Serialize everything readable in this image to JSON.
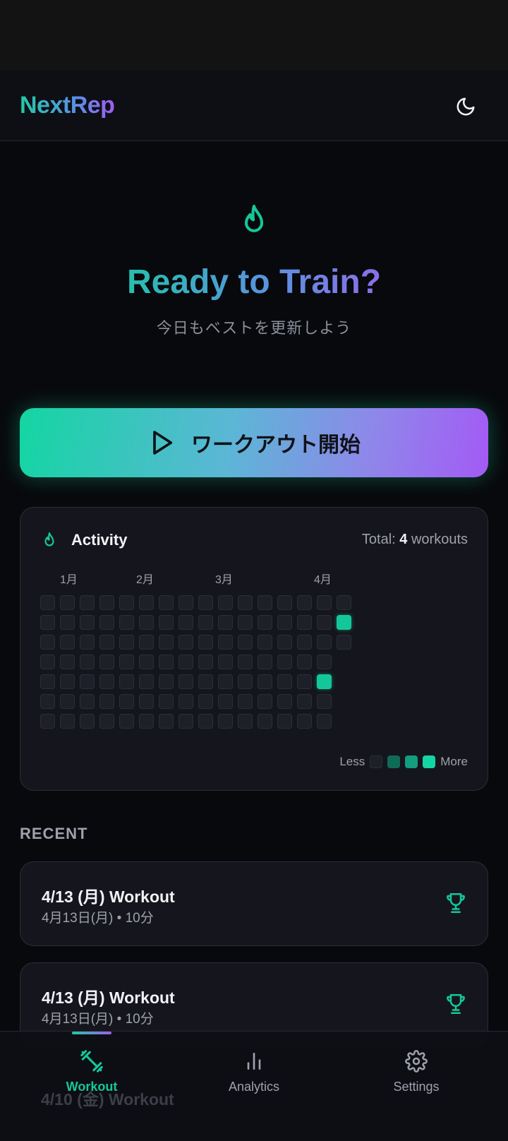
{
  "header": {
    "app_name": "NextRep",
    "theme_icon": "moon-icon"
  },
  "hero": {
    "icon": "flame-icon",
    "title": "Ready to Train?",
    "subtitle": "今日もベストを更新しよう"
  },
  "start_button": {
    "label": "ワークアウト開始",
    "icon": "play-icon"
  },
  "activity": {
    "title": "Activity",
    "total_prefix": "Total:",
    "total_count": "4",
    "total_suffix": "workouts",
    "months": [
      "1月",
      "2月",
      "3月",
      "4月"
    ],
    "weeks": 16,
    "days_per_week": 7,
    "highlighted": [
      {
        "week": 15,
        "day": 1,
        "level": 3
      },
      {
        "week": 14,
        "day": 4,
        "level": 3
      }
    ],
    "legend_less": "Less",
    "legend_more": "More",
    "legend_colors": [
      "#1e2029",
      "#0f6b57",
      "#129e7f",
      "#14d6a4"
    ],
    "accent_color": "#14c79a"
  },
  "recent": {
    "label": "RECENT",
    "items": [
      {
        "title": "4/13 (月) Workout",
        "subtitle": "4月13日(月) • 10分",
        "icon": "trophy-icon"
      },
      {
        "title": "4/13 (月) Workout",
        "subtitle": "4月13日(月) • 10分",
        "icon": "trophy-icon"
      },
      {
        "title": "4/10 (金) Workout"
      }
    ]
  },
  "nav": {
    "items": [
      {
        "label": "Workout",
        "icon": "dumbbell-icon",
        "active": true
      },
      {
        "label": "Analytics",
        "icon": "bar-chart-icon",
        "active": false
      },
      {
        "label": "Settings",
        "icon": "gear-icon",
        "active": false
      }
    ]
  }
}
